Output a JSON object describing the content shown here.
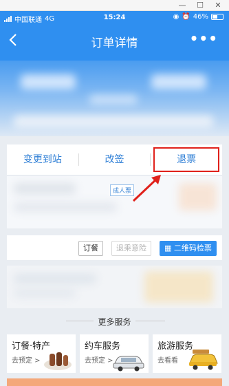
{
  "status_bar": {
    "carrier": "中国联通",
    "network": "4G",
    "time": "15:24",
    "battery": "46%"
  },
  "header": {
    "title": "订单详情",
    "more_label": "•••"
  },
  "actions": [
    {
      "label": "变更到站"
    },
    {
      "label": "改签"
    },
    {
      "label": "退票"
    }
  ],
  "passenger": {
    "tag": "成人票"
  },
  "order_buttons": {
    "meal": "订餐",
    "insurance": "退乘意险",
    "qr": "二维码检票"
  },
  "more_services": {
    "title": "更多服务",
    "items": [
      {
        "name": "订餐·特产",
        "sub": "去预定 >"
      },
      {
        "name": "约车服务",
        "sub": "去预定 >"
      },
      {
        "name": "旅游服务",
        "sub": "去看看"
      }
    ]
  },
  "colors": {
    "brand_blue": "#2f8ff0",
    "highlight_red": "#e0211b"
  }
}
